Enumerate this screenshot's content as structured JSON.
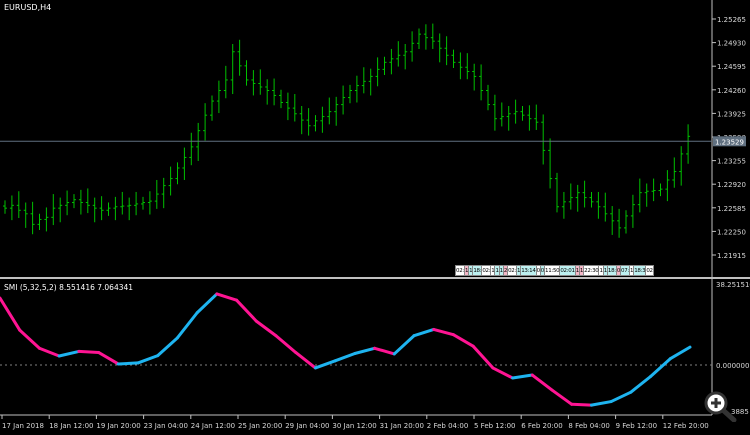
{
  "chart_window": {
    "symbol_label": "EURUSD,H4",
    "current_price_label": "1.23529",
    "price_axis": [
      "1.25265",
      "1.24930",
      "1.24595",
      "1.24260",
      "1.23925",
      "1.23590",
      "1.23255",
      "1.22920",
      "1.22585",
      "1.22250",
      "1.21915"
    ],
    "time_axis": [
      "17 Jan 2018",
      "18 Jan 12:00",
      "19 Jan 20:00",
      "23 Jan 04:00",
      "24 Jan 12:00",
      "25 Jan 20:00",
      "29 Jan 04:00",
      "30 Jan 12:00",
      "31 Jan 20:00",
      "2 Feb 04:00",
      "5 Feb 12:00",
      "6 Feb 20:00",
      "8 Feb 04:00",
      "9 Feb 12:00",
      "12 Feb 20:00"
    ],
    "trade_markers": [
      {
        "t": "02:",
        "c": "white"
      },
      {
        "t": "1",
        "c": "pink"
      },
      {
        "t": "1",
        "c": "cyan"
      },
      {
        "t": "18:",
        "c": "cyan"
      },
      {
        "t": "02:",
        "c": "white"
      },
      {
        "t": "1",
        "c": "white"
      },
      {
        "t": "1",
        "c": "cyan"
      },
      {
        "t": "1",
        "c": "cyan"
      },
      {
        "t": "2",
        "c": "pink"
      },
      {
        "t": "02:",
        "c": "white"
      },
      {
        "t": "1",
        "c": "cyan"
      },
      {
        "t": "13:14",
        "c": "cyan"
      },
      {
        "t": "0",
        "c": "white"
      },
      {
        "t": "0",
        "c": "cyan"
      },
      {
        "t": "11:50",
        "c": "white"
      },
      {
        "t": "02:01",
        "c": "cyan"
      },
      {
        "t": "1",
        "c": "pink"
      },
      {
        "t": "1",
        "c": "pink"
      },
      {
        "t": "22:30",
        "c": "white"
      },
      {
        "t": "1",
        "c": "white"
      },
      {
        "t": "1",
        "c": "cyan"
      },
      {
        "t": "18:",
        "c": "cyan"
      },
      {
        "t": "0",
        "c": "pink"
      },
      {
        "t": "07:",
        "c": "cyan"
      },
      {
        "t": "1",
        "c": "white"
      },
      {
        "t": "18:3",
        "c": "cyan"
      },
      {
        "t": "02",
        "c": "white"
      }
    ],
    "colors": {
      "bars": "#00c000",
      "current_line": "#607080",
      "smi_up": "#1eb4f0",
      "smi_down": "#ff1493",
      "zero_line": "#808080"
    }
  },
  "indicator": {
    "title": "SMI (5,32,5,2) 8.551416 7.064341",
    "axis_top": "38.251510",
    "axis_zero": "0.000000",
    "axis_bottom_partial": "3885"
  },
  "chart_data": [
    {
      "type": "ohlc",
      "title": "EURUSD,H4",
      "ylim": [
        1.2172,
        1.255
      ],
      "close": [
        1.2258,
        1.2262,
        1.2255,
        1.225,
        1.2235,
        1.2242,
        1.2245,
        1.2258,
        1.2262,
        1.2266,
        1.227,
        1.2266,
        1.2262,
        1.2258,
        1.2255,
        1.2258,
        1.226,
        1.2261,
        1.2262,
        1.2264,
        1.2266,
        1.2268,
        1.2278,
        1.229,
        1.23,
        1.2315,
        1.233,
        1.2345,
        1.2368,
        1.239,
        1.241,
        1.2425,
        1.244,
        1.248,
        1.246,
        1.244,
        1.2435,
        1.243,
        1.2425,
        1.2418,
        1.2408,
        1.24,
        1.2392,
        1.2383,
        1.2375,
        1.2382,
        1.2388,
        1.2395,
        1.2405,
        1.2415,
        1.2425,
        1.2432,
        1.2438,
        1.2445,
        1.2455,
        1.2465,
        1.247,
        1.2475,
        1.248,
        1.2492,
        1.2505,
        1.25,
        1.2495,
        1.2485,
        1.2475,
        1.2465,
        1.2458,
        1.2452,
        1.2445,
        1.2425,
        1.2405,
        1.2385,
        1.2388,
        1.2392,
        1.2395,
        1.239,
        1.2385,
        1.238,
        1.234,
        1.23,
        1.226,
        1.2267,
        1.2273,
        1.228,
        1.2273,
        1.2267,
        1.226,
        1.225,
        1.224,
        1.223,
        1.2247,
        1.2263,
        1.228,
        1.2282,
        1.2283,
        1.2285,
        1.2298,
        1.231,
        1.2335,
        1.236
      ]
    },
    {
      "type": "line",
      "title": "SMI (5,32,5,2)",
      "ylim": [
        -22,
        38.25
      ],
      "values": [
        32,
        16.7,
        8,
        4.3,
        6.5,
        6,
        0.5,
        1,
        4.5,
        13,
        25,
        34,
        31,
        21,
        14,
        6,
        -1.4,
        2,
        5.5,
        8,
        5.3,
        14,
        17,
        14.5,
        9,
        -1.4,
        -6.2,
        -4.8,
        -12,
        -18.8,
        -19.2,
        -17.5,
        -13,
        -5.5,
        3,
        8.55
      ]
    }
  ]
}
